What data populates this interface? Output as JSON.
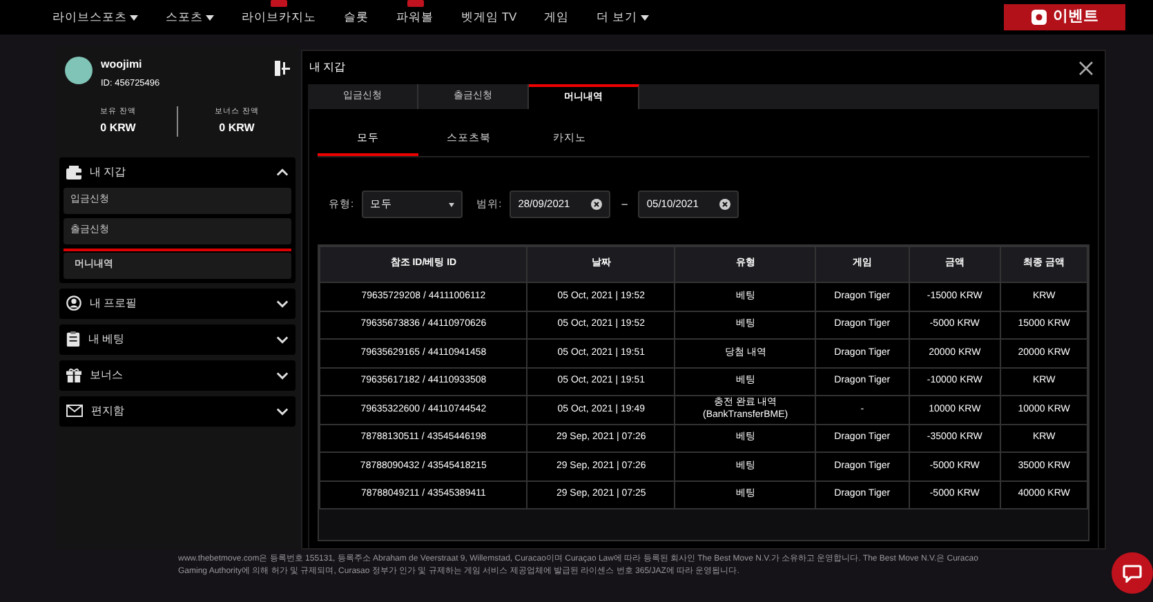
{
  "nav": {
    "items": [
      {
        "label": "라이브스포츠",
        "dropdown": true,
        "badge": false
      },
      {
        "label": "스포츠",
        "dropdown": true,
        "badge": false
      },
      {
        "label": "라이브카지노",
        "dropdown": false,
        "badge": true
      },
      {
        "label": "슬롯",
        "dropdown": false,
        "badge": false
      },
      {
        "label": "파워볼",
        "dropdown": false,
        "badge": true
      },
      {
        "label": "벳게임 TV",
        "dropdown": false,
        "badge": false
      },
      {
        "label": "게임",
        "dropdown": false,
        "badge": false
      },
      {
        "label": "더 보기",
        "dropdown": true,
        "badge": false
      }
    ],
    "event_button": "이벤트"
  },
  "sidebar": {
    "username": "woojimi",
    "user_id": "ID: 456725496",
    "balances": [
      {
        "label": "보유 잔액",
        "value": "0 KRW"
      },
      {
        "label": "보너스 잔액",
        "value": "0 KRW"
      }
    ],
    "menu": [
      {
        "label": "내 지갑",
        "kind": "wallet",
        "expanded": true,
        "children": [
          {
            "label": "입금신청",
            "selected": false
          },
          {
            "label": "출금신청",
            "selected": false
          },
          {
            "label": "머니내역",
            "selected": true
          }
        ]
      },
      {
        "label": "내 프로필",
        "kind": "profile",
        "expanded": false
      },
      {
        "label": "내 베팅",
        "kind": "betting",
        "expanded": false
      },
      {
        "label": "보너스",
        "kind": "bonus",
        "expanded": false
      },
      {
        "label": "편지함",
        "kind": "mail",
        "expanded": false
      }
    ]
  },
  "modal": {
    "title": "내 지갑",
    "tabs": [
      {
        "label": "입금신청",
        "selected": false
      },
      {
        "label": "출금신청",
        "selected": false
      },
      {
        "label": "머니내역",
        "selected": true
      }
    ],
    "subtabs": [
      {
        "label": "모두",
        "selected": true
      },
      {
        "label": "스포츠북",
        "selected": false
      },
      {
        "label": "카지노",
        "selected": false
      }
    ],
    "filters": {
      "type_label": "유형:",
      "type_value": "모두",
      "range_label": "범위:",
      "date_from": "28/09/2021",
      "separator": "–",
      "date_to": "05/10/2021"
    },
    "table": {
      "columns": [
        "참조 ID/베팅 ID",
        "날짜",
        "유형",
        "게임",
        "금액",
        "최종 금액"
      ],
      "rows": [
        [
          "79635729208 / 44111006112",
          "05 Oct, 2021 | 19:52",
          "베팅",
          "Dragon Tiger",
          "-15000 KRW",
          "KRW"
        ],
        [
          "79635673836 / 44110970626",
          "05 Oct, 2021 | 19:52",
          "베팅",
          "Dragon Tiger",
          "-5000 KRW",
          "15000 KRW"
        ],
        [
          "79635629165 / 44110941458",
          "05 Oct, 2021 | 19:51",
          "당첨 내역",
          "Dragon Tiger",
          "20000 KRW",
          "20000 KRW"
        ],
        [
          "79635617182 / 44110933508",
          "05 Oct, 2021 | 19:51",
          "베팅",
          "Dragon Tiger",
          "-10000 KRW",
          "KRW"
        ],
        [
          "79635322600 / 44110744542",
          "05 Oct, 2021 | 19:49",
          "충전 완료 내역\n(BankTransferBME)",
          "-",
          "10000 KRW",
          "10000 KRW"
        ],
        [
          "78788130511 / 43545446198",
          "29 Sep, 2021 | 07:26",
          "베팅",
          "Dragon Tiger",
          "-35000 KRW",
          "KRW"
        ],
        [
          "78788090432 / 43545418215",
          "29 Sep, 2021 | 07:26",
          "베팅",
          "Dragon Tiger",
          "-5000 KRW",
          "35000 KRW"
        ],
        [
          "78788049211 / 43545389411",
          "29 Sep, 2021 | 07:25",
          "베팅",
          "Dragon Tiger",
          "-5000 KRW",
          "40000 KRW"
        ]
      ]
    }
  },
  "footer": "www.thebetmove.com은 등록번호 155131, 등록주소 Abraham de Veerstraat 9, Willemstad, Curacao이며 Curaçao Law에 따라 등록된 회사인 The Best Move N.V.가 소유하고 운영합니다. The Best Move N.V.은 Curacao Gaming Authority에 의해 허가 및 규제되며, Curasao 정부가 인가 및 규제하는 게임 서비스 제공업체에 발급된 라이센스 번호 365/JAZ에 따라 운영됩니다."
}
